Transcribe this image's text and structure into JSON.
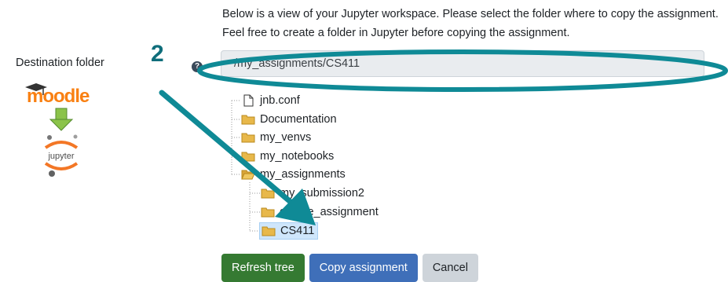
{
  "instructions": {
    "line1": "Below is a view of your Jupyter workspace. Please select the folder where to copy the assignment.",
    "line2": "Feel free to create a folder in Jupyter before copying the assignment."
  },
  "destination": {
    "label": "Destination folder",
    "path_value": "/my_assignments/CS411",
    "help_icon": "?",
    "logos": {
      "moodle": "moodle",
      "jupyter": "jupyter"
    }
  },
  "annotation": {
    "step_number": "2",
    "color": "#0f8a96"
  },
  "tree": {
    "items": [
      {
        "label": "jnb.conf",
        "type": "file"
      },
      {
        "label": "Documentation",
        "type": "folder"
      },
      {
        "label": "my_venvs",
        "type": "folder"
      },
      {
        "label": "my_notebooks",
        "type": "folder"
      },
      {
        "label": "my_assignments",
        "type": "folder-open"
      },
      {
        "label": "my_submission2",
        "type": "folder"
      },
      {
        "label": "course_assignment",
        "type": "folder"
      },
      {
        "label": "CS411",
        "type": "folder",
        "selected": true
      }
    ]
  },
  "buttons": {
    "refresh": "Refresh tree",
    "copy": "Copy assignment",
    "cancel": "Cancel"
  },
  "colors": {
    "refresh": "#357a32",
    "copy": "#3f6fb9",
    "cancel": "#ced4da",
    "selection": "#cfe6fb"
  }
}
